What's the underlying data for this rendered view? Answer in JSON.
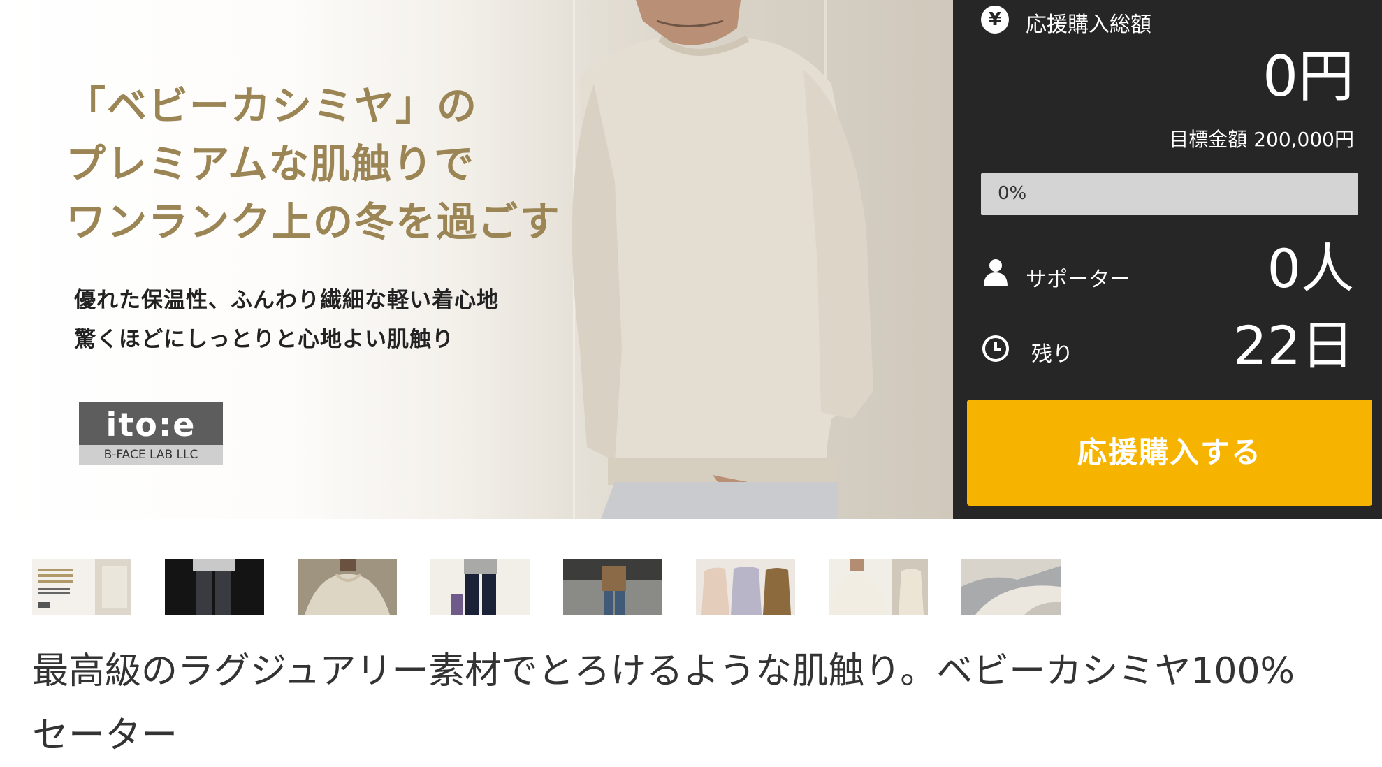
{
  "hero": {
    "headline": "「ベビーカシミヤ」の\nプレミアムな肌触りで\nワンランク上の冬を過ごす",
    "subcopy": "優れた保温性、ふんわり繊細な軽い着心地\n驚くほどにしっとりと心地よい肌触り",
    "logo_main": "ito:e",
    "logo_sub": "B-FACE LAB LLC"
  },
  "panel": {
    "total_icon": "yen-circle-icon",
    "total_label": "応援購入総額",
    "total_amount": "0円",
    "goal_text": "目標金額 200,000円",
    "progress": 0,
    "progress_text": "0%",
    "supporters_icon": "person-icon",
    "supporters_label": "サポーター",
    "supporters_value": "0人",
    "remaining_icon": "clock-icon",
    "remaining_label": "残り",
    "remaining_value": "22日",
    "cta_label": "応援購入する",
    "accent_color": "#f6b400",
    "panel_color": "#262626"
  },
  "thumbnails": [
    {
      "name": "thumb-hero-banner"
    },
    {
      "name": "thumb-pants-dark"
    },
    {
      "name": "thumb-sweater-closeup"
    },
    {
      "name": "thumb-full-body-navy"
    },
    {
      "name": "thumb-street-brown"
    },
    {
      "name": "thumb-three-colors"
    },
    {
      "name": "thumb-two-models"
    },
    {
      "name": "thumb-folded-knit"
    }
  ],
  "product_title": "最高級のラグジュアリー素材でとろけるような肌触り。ベビーカシミヤ100%\nセーター"
}
